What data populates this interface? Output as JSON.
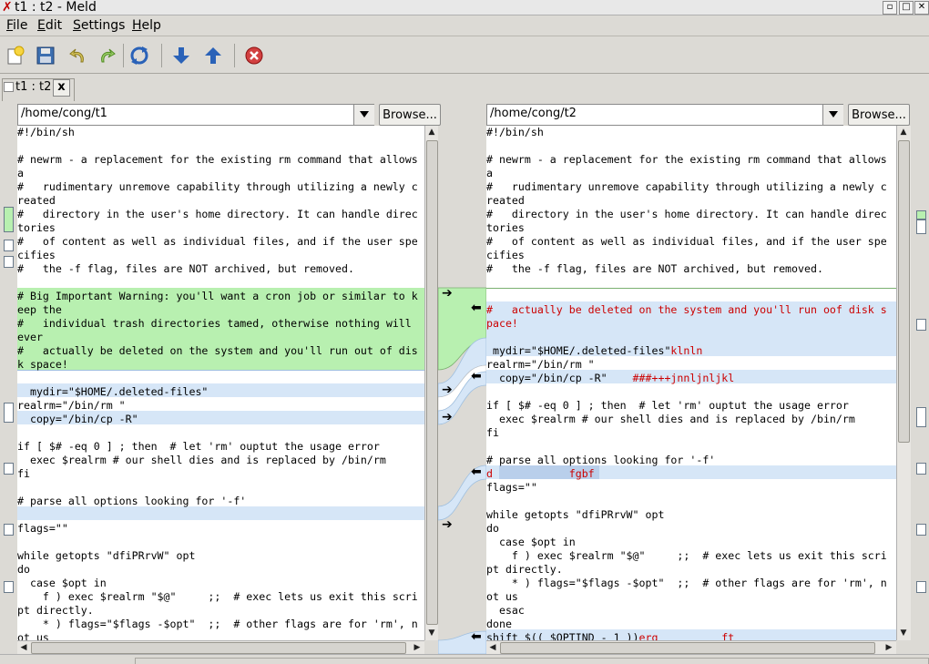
{
  "window": {
    "title": "t1 : t2 - Meld",
    "title_icon": "meld-icon"
  },
  "menu": [
    "File",
    "Edit",
    "Settings",
    "Help"
  ],
  "toolbar": {
    "buttons": [
      "new-icon",
      "save-icon",
      "undo-icon",
      "redo-icon",
      "refresh-icon",
      "down-arrow-icon",
      "up-arrow-icon",
      "stop-icon"
    ]
  },
  "tab": {
    "label": "t1 : t2",
    "close": "x"
  },
  "left": {
    "path": "/home/cong/t1",
    "browse": "Browse..."
  },
  "right": {
    "path": "/home/cong/t2",
    "browse": "Browse..."
  },
  "colors": {
    "insert": "#b8f0b0",
    "change": "#d6e6f7",
    "inline_change": "#c8d9f0",
    "removed_text": "#cc0000",
    "bg": "#dcdad5"
  },
  "left_lines": [
    "#!/bin/sh",
    "",
    "# newrm - a replacement for the existing rm command that allows",
    "a",
    "#   rudimentary unremove capability through utilizing a newly c",
    "reated",
    "#   directory in the user's home directory. It can handle direc",
    "tories",
    "#   of content as well as individual files, and if the user spe",
    "cifies",
    "#   the -f flag, files are NOT archived, but removed.",
    "",
    "# Big Important Warning: you'll want a cron job or similar to k",
    "eep the",
    "#   individual trash directories tamed, otherwise nothing will",
    "ever",
    "#   actually be deleted on the system and you'll run out of dis",
    "k space!",
    "",
    "  mydir=\"$HOME/.deleted-files\"",
    "realrm=\"/bin/rm \"",
    "  copy=\"/bin/cp -R\"",
    "",
    "if [ $# -eq 0 ] ; then  # let 'rm' ouptut the usage error",
    "  exec $realrm # our shell dies and is replaced by /bin/rm",
    "fi",
    "",
    "# parse all options looking for '-f'",
    "",
    "flags=\"\"",
    "",
    "while getopts \"dfiPRrvW\" opt",
    "do",
    "  case $opt in",
    "    f ) exec $realrm \"$@\"     ;;  # exec lets us exit this scri",
    "pt directly.",
    "    * ) flags=\"$flags -$opt\"  ;;  # other flags are for 'rm', n",
    "ot us"
  ],
  "right_lines": [
    "#!/bin/sh",
    "",
    "# newrm - a replacement for the existing rm command that allows",
    "a",
    "#   rudimentary unremove capability through utilizing a newly c",
    "reated",
    "#   directory in the user's home directory. It can handle direc",
    "tories",
    "#   of content as well as individual files, and if the user spe",
    "cifies",
    "#   the -f flag, files are NOT archived, but removed.",
    "",
    "",
    "#   actually be deleted on the system and you'll run oof disk s",
    "pace!",
    "",
    " mydir=\"$HOME/.deleted-files\"klnln",
    "realrm=\"/bin/rm \"",
    "  copy=\"/bin/cp -R\"    ###+++jnnljnljkl",
    "",
    "if [ $# -eq 0 ] ; then  # let 'rm' ouptut the usage error",
    "  exec $realrm # our shell dies and is replaced by /bin/rm",
    "fi",
    "",
    "# parse all options looking for '-f'",
    "d            fgbf",
    "flags=\"\"",
    "",
    "while getopts \"dfiPRrvW\" opt",
    "do",
    "  case $opt in",
    "    f ) exec $realrm \"$@\"     ;;  # exec lets us exit this scri",
    "pt directly.",
    "    * ) flags=\"$flags -$opt\"  ;;  # other flags are for 'rm', n",
    "ot us",
    "  esac",
    "done",
    "shift $(( $OPTIND - 1 ))erg          ft"
  ]
}
